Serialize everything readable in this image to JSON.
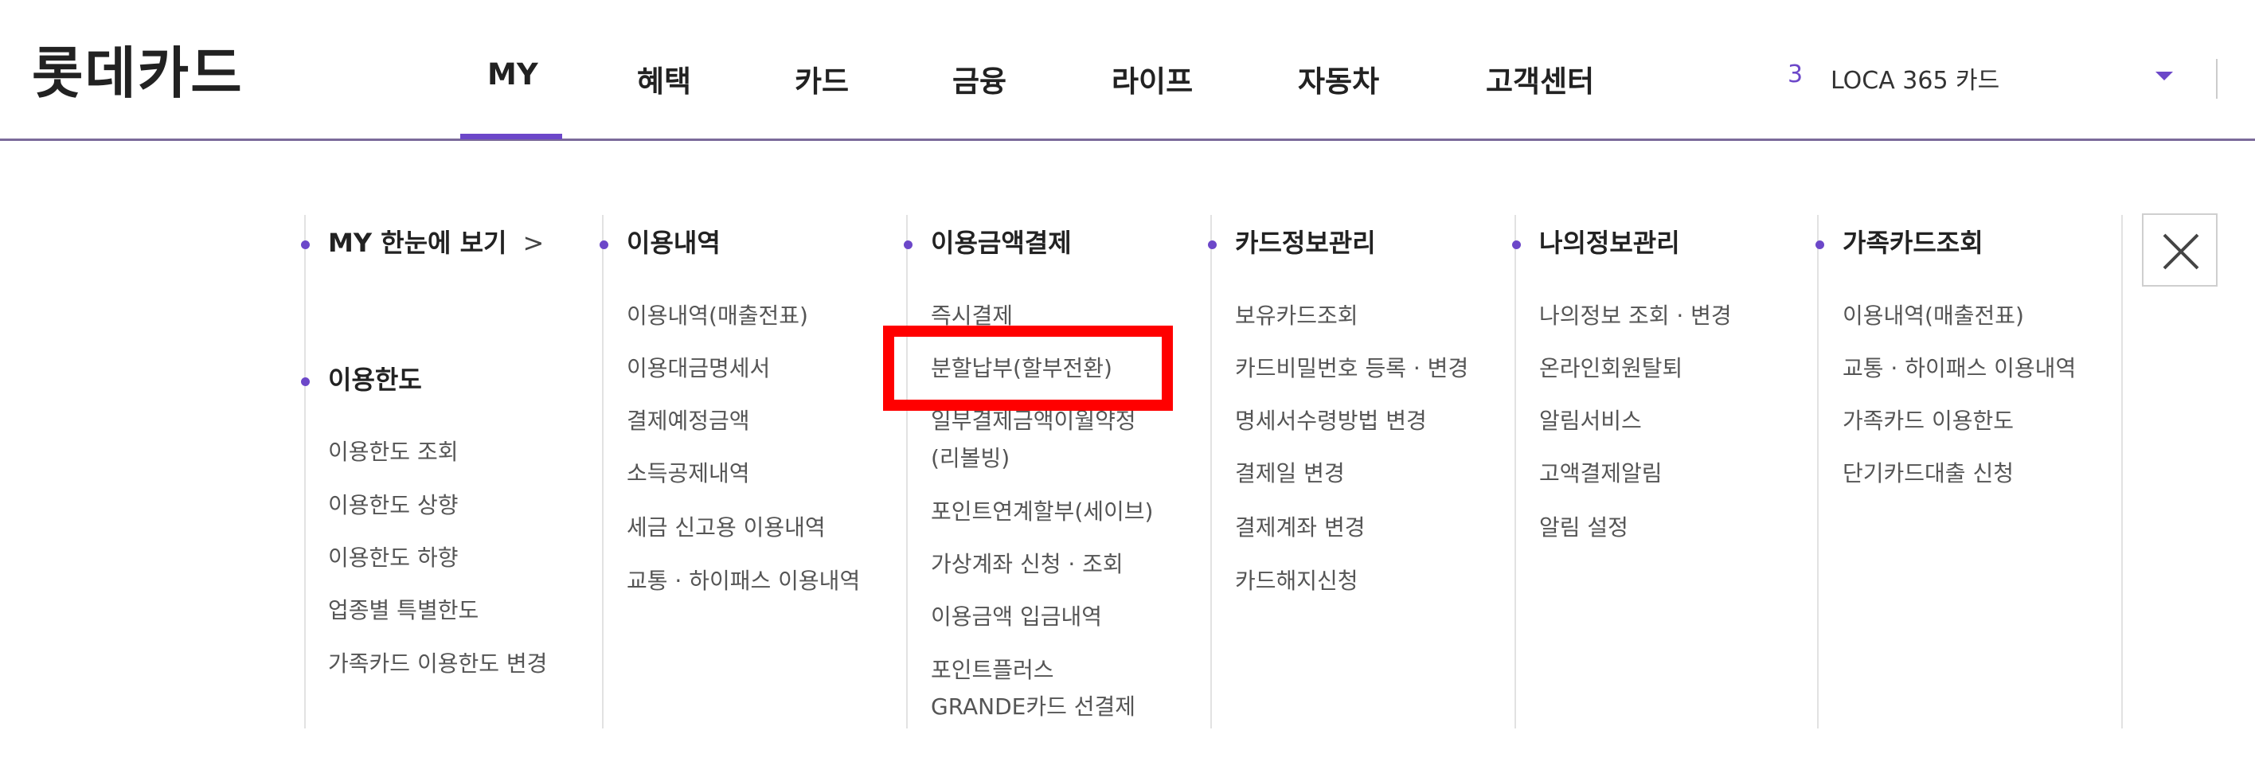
{
  "logo": "롯데카드",
  "gnb": [
    "MY",
    "혜택",
    "카드",
    "금융",
    "라이프",
    "자동차",
    "고객센터"
  ],
  "active_tab": "MY",
  "user": {
    "badge": "3",
    "card": "LOCA 365 카드"
  },
  "columns": [
    {
      "groups": [
        {
          "title": "MY 한눈에 보기",
          "chevron": ">",
          "items": []
        },
        {
          "title": "이용한도",
          "items": [
            "이용한도 조회",
            "이용한도 상향",
            "이용한도 하향",
            "업종별 특별한도",
            "가족카드 이용한도 변경"
          ]
        }
      ]
    },
    {
      "groups": [
        {
          "title": "이용내역",
          "items": [
            "이용내역(매출전표)",
            "이용대금명세서",
            "결제예정금액",
            "소득공제내역",
            "세금 신고용 이용내역",
            "교통 · 하이패스 이용내역"
          ]
        }
      ]
    },
    {
      "groups": [
        {
          "title": "이용금액결제",
          "items": [
            "즉시결제",
            "분할납부(할부전환)",
            "일부결제금액이월약정",
            "(리볼빙)",
            "포인트연계할부(세이브)",
            "가상계좌 신청 · 조회",
            "이용금액 입금내역",
            "포인트플러스",
            "GRANDE카드 선결제"
          ]
        }
      ]
    },
    {
      "groups": [
        {
          "title": "카드정보관리",
          "items": [
            "보유카드조회",
            "카드비밀번호 등록 · 변경",
            "명세서수령방법 변경",
            "결제일 변경",
            "결제계좌 변경",
            "카드해지신청"
          ]
        }
      ]
    },
    {
      "groups": [
        {
          "title": "나의정보관리",
          "items": [
            "나의정보 조회 · 변경",
            "온라인회원탈퇴",
            "알림서비스",
            "고액결제알림",
            "알림 설정"
          ]
        }
      ]
    },
    {
      "groups": [
        {
          "title": "가족카드조회",
          "items": [
            "이용내역(매출전표)",
            "교통 · 하이패스 이용내역",
            "가족카드 이용한도",
            "단기카드대출 신청"
          ]
        }
      ]
    }
  ],
  "colors": {
    "accent": "#6c47c9",
    "highlight": "#ff0000",
    "header_line": "#7b6a9a"
  },
  "icons": {
    "close": "close-icon",
    "caret": "caret-down-icon",
    "chevron": "chevron-right-icon"
  }
}
